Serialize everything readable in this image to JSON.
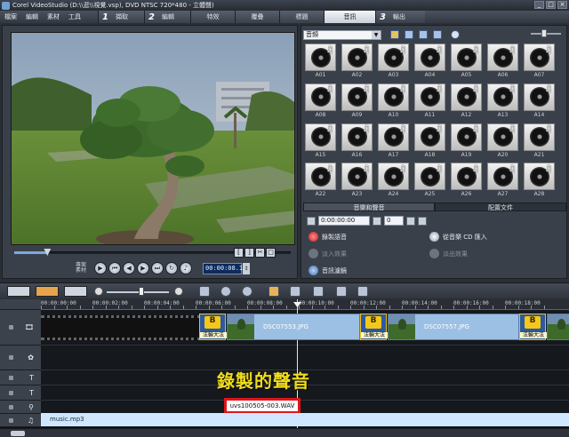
{
  "window": {
    "title": "Corel VideoStudio (D:\\\\逛\\\\視覺.vsp), DVD NTSC 720*480 - 立體聲)"
  },
  "menu": {
    "items": [
      "檔案",
      "編輯",
      "素材",
      "工具"
    ]
  },
  "steps": [
    {
      "num": "1",
      "label": "擷取"
    },
    {
      "num": "2",
      "label": "編輯"
    },
    {
      "num": "",
      "label": "特效"
    },
    {
      "num": "",
      "label": "覆疊"
    },
    {
      "num": "",
      "label": "標題"
    },
    {
      "num": "",
      "label": "音訊"
    },
    {
      "num": "3",
      "label": "輸出"
    }
  ],
  "preview": {
    "timecode": "00:00:08.15",
    "material_label": "專案 素材",
    "scrubber_progress": 0.12
  },
  "library": {
    "category": "音頻",
    "clips": [
      "A01",
      "A02",
      "A03",
      "A04",
      "A05",
      "A06",
      "A07",
      "A08",
      "A09",
      "A10",
      "A11",
      "A12",
      "A13",
      "A14",
      "A15",
      "A16",
      "A17",
      "A18",
      "A19",
      "A20",
      "A21",
      "A22",
      "A23",
      "A24",
      "A25",
      "A26",
      "A27",
      "A28"
    ]
  },
  "options": {
    "tabs": [
      "音樂和聲音",
      "配置文件"
    ],
    "duration": "0:00:00:00",
    "volume": "0",
    "record_voice": "錄製語音",
    "import_cd": "從音樂 CD 匯入",
    "fade_in": "淡入效果",
    "fade_out": "淡出效果",
    "audio_filter": "音訊濾鏡"
  },
  "timeline": {
    "ticks": [
      "00:00:00:00",
      "00:00:02:00",
      "00:00:04:00",
      "00:00:06:00",
      "00:00:08:00",
      "00:00:10:00",
      "00:00:12:00",
      "00:00:14:00",
      "00:00:16:00",
      "00:00:18:00"
    ],
    "video_clips": [
      {
        "title": "法輪大法",
        "photo": "DSC07553.JPG"
      },
      {
        "title": "法輪大法",
        "photo": "DSC07557.JPG"
      }
    ],
    "overlay_caption": "錄製的聲音",
    "voice_clip": "uvs100505-003.WAV",
    "music_clip": "music.mp3",
    "track_labels": [
      "T",
      "T",
      "",
      "♫"
    ]
  }
}
